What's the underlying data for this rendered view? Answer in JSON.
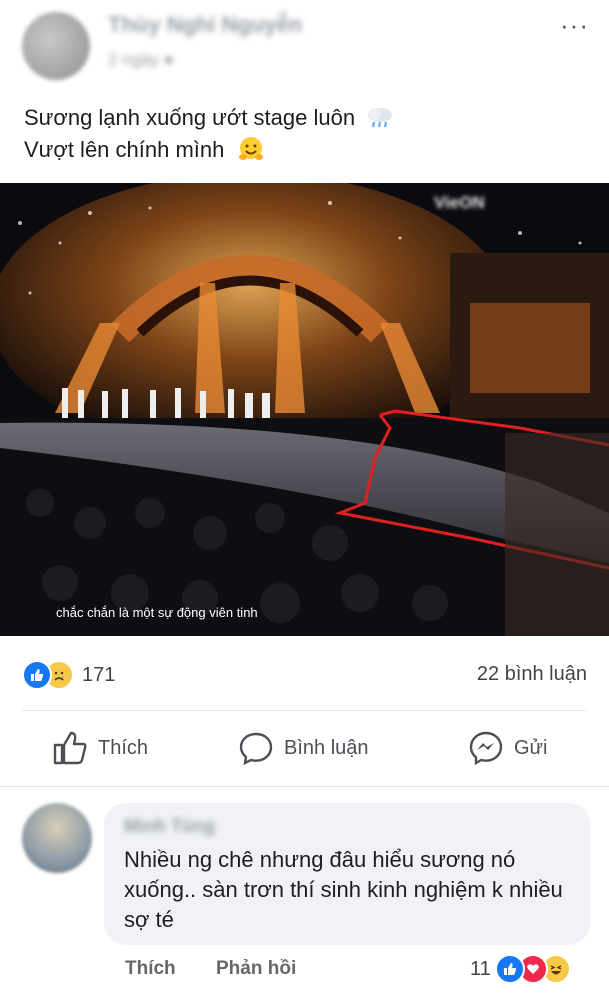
{
  "post": {
    "author": "Thùy Nghi Nguyễn",
    "time": "2 ngày",
    "caption_line1": "Sương lạnh xuống ướt stage luôn",
    "caption_line2": "Vượt lên chính mình"
  },
  "video": {
    "subtitle": "chắc chắn là một sự động viên tinh",
    "channel_badge": "VieON"
  },
  "stats": {
    "reaction_count": "171",
    "comments_label": "22 bình luận"
  },
  "actions": {
    "like_label": "Thích",
    "comment_label": "Bình luận",
    "send_label": "Gửi"
  },
  "comment": {
    "author": "Minh Tùng",
    "text": "Nhiều ng chê nhưng đâu hiểu sương nó xuống.. sàn trơn thí sinh kinh nghiệm k nhiều sợ té",
    "like_label": "Thích",
    "reply_label": "Phản hồi",
    "reaction_count": "11"
  },
  "colors": {
    "accent_blue": "#1877f2",
    "red_annotation": "#e02020",
    "bubble_bg": "#f0f2f5"
  }
}
